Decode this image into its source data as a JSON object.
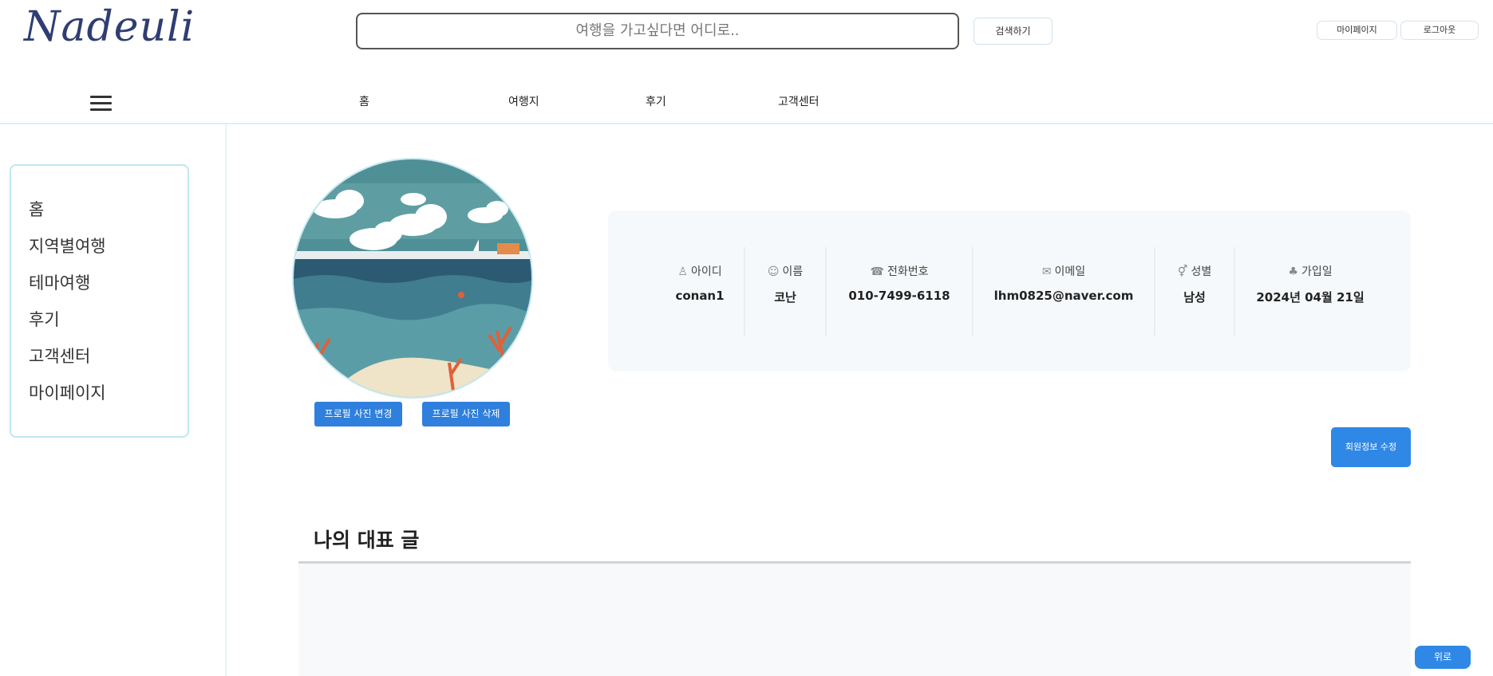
{
  "header": {
    "logo": "Nadeuli",
    "search_placeholder": "여행을 가고싶다면 어디로..",
    "search_button": "검색하기",
    "mypage_button": "마이페이지",
    "logout_button": "로그아웃"
  },
  "nav": {
    "items": [
      "홈",
      "여행지",
      "후기",
      "고객센터"
    ]
  },
  "sidebar": {
    "items": [
      "홈",
      "지역별여행",
      "테마여행",
      "후기",
      "고객센터",
      "마이페이지"
    ]
  },
  "profile": {
    "change_photo": "프로필 사진 변경",
    "delete_photo": "프로필 사진 삭제",
    "fields": [
      {
        "label": "아이디",
        "value": "conan1",
        "icon": "user-icon"
      },
      {
        "label": "이름",
        "value": "코난",
        "icon": "smile-icon"
      },
      {
        "label": "전화번호",
        "value": "010-7499-6118",
        "icon": "phone-icon"
      },
      {
        "label": "이메일",
        "value": "lhm0825@naver.com",
        "icon": "mail-icon"
      },
      {
        "label": "성별",
        "value": "남성",
        "icon": "gender-icon"
      },
      {
        "label": "가입일",
        "value": "2024년 04월 21일",
        "icon": "clover-icon"
      }
    ],
    "edit_button": "회원정보 수정"
  },
  "posts": {
    "title": "나의 대표 글"
  },
  "scroll_top": "위로",
  "colors": {
    "primary": "#2f88e6",
    "logo": "#2f3d73",
    "accent_border": "#bfe7f2"
  }
}
